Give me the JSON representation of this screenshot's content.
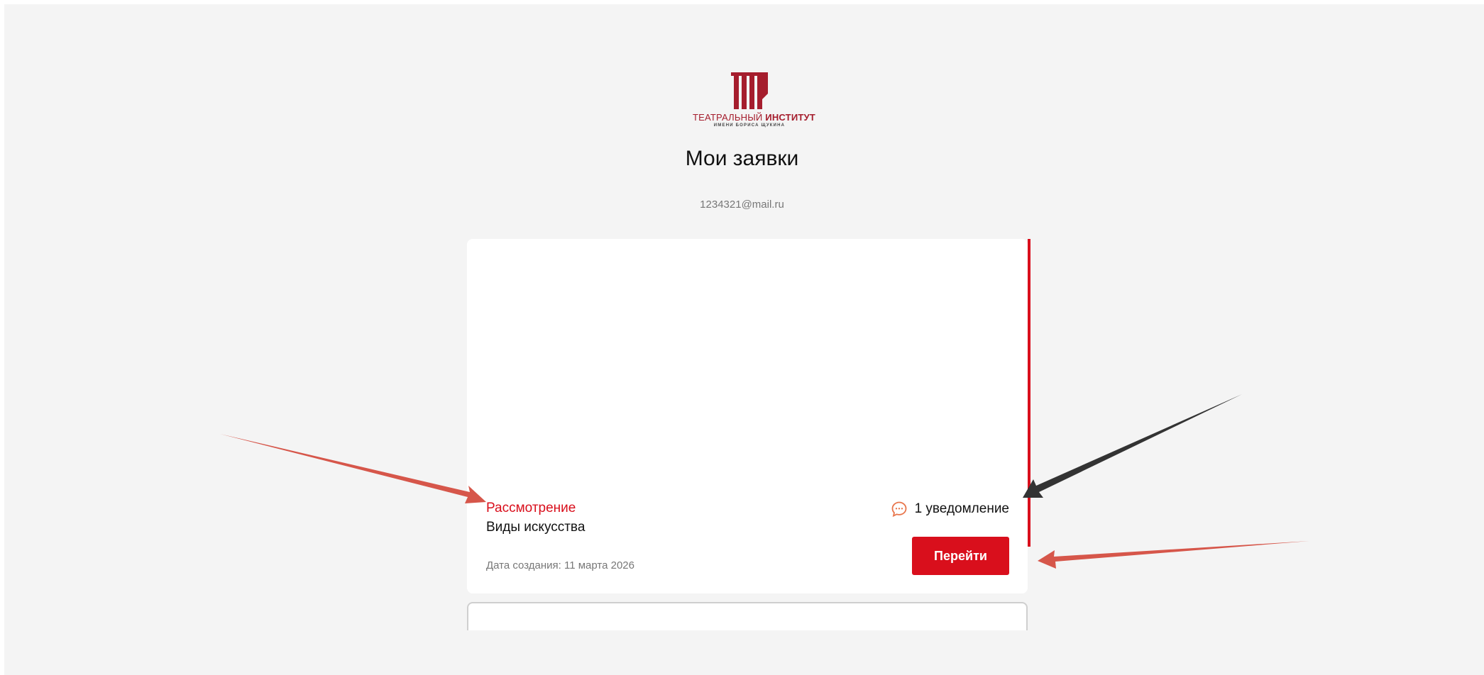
{
  "logo": {
    "line1_normal": "ТЕАТРАЛЬНЫЙ",
    "line1_bold": "ИНСТИТУТ",
    "line2": "ИМЕНИ БОРИСА ЩУКИНА"
  },
  "page": {
    "title": "Мои заявки",
    "user_email": "1234321@mail.ru"
  },
  "application": {
    "status": "Рассмотрение",
    "program": "Виды искусства",
    "created": "Дата создания: 11 марта 2026",
    "notifications": "1 уведомление",
    "button_label": "Перейти"
  },
  "colors": {
    "accent": "#d90f1c",
    "brand": "#a51d2d",
    "notification_icon": "#e8754b",
    "annotation_red": "#d6564a",
    "annotation_dark": "#333333"
  },
  "icons": {
    "notification": "chat-bubble-icon"
  }
}
